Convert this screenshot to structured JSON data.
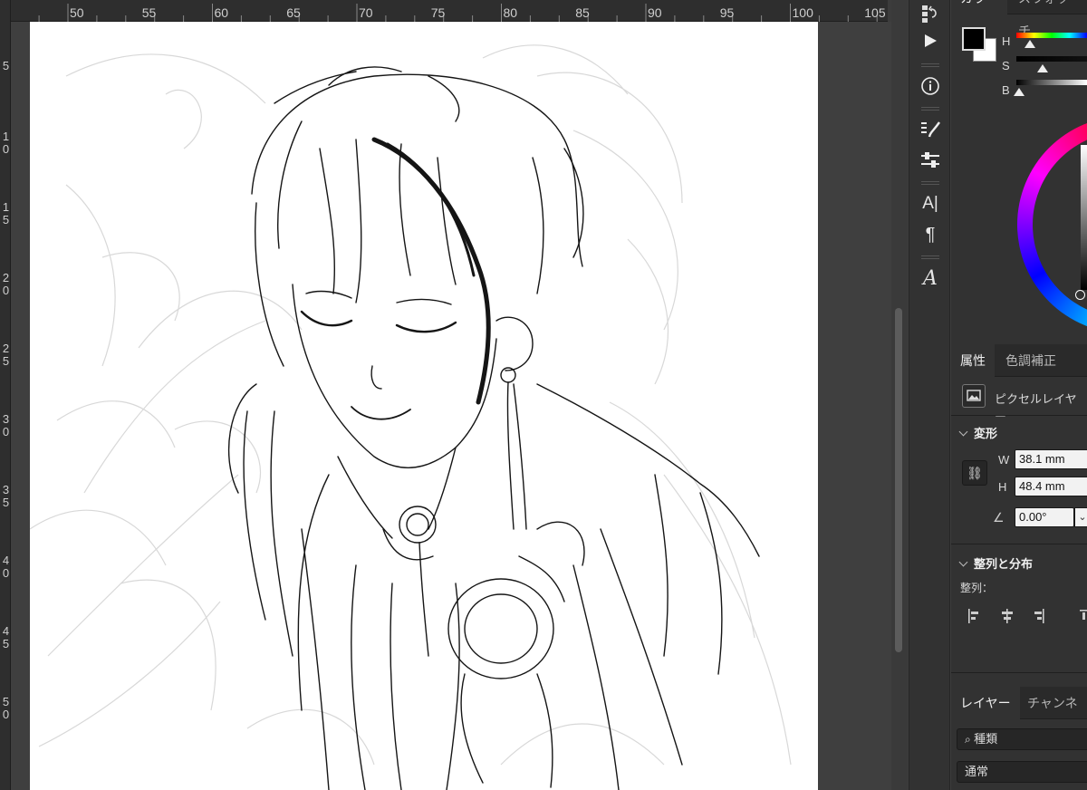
{
  "ruler": {
    "top_labels": [
      "50",
      "55",
      "60",
      "65",
      "70",
      "75",
      "80",
      "85",
      "90",
      "95",
      "100",
      "105"
    ],
    "left_labels": [
      "5",
      "10",
      "15",
      "20",
      "25",
      "30",
      "35",
      "40",
      "45",
      "50"
    ]
  },
  "toolstrip": {
    "icons": [
      "history-icon",
      "play-icon",
      "info-icon",
      "brush-settings-icon",
      "adjustments-icon",
      "character-icon",
      "paragraph-icon",
      "glyphs-icon"
    ]
  },
  "color_panel": {
    "tabs": [
      "カラー",
      "スウォッチ"
    ],
    "h_label": "H",
    "s_label": "S",
    "b_label": "B",
    "h_level": 0.19,
    "s_level": 0.37,
    "b_level": 0.04,
    "foreground": "#000000",
    "background": "#ffffff"
  },
  "properties": {
    "tabs": [
      "属性",
      "色調補正"
    ],
    "layer_type": "ピクセルレイヤー",
    "transform_title": "変形",
    "w_label": "W",
    "w_value": "38.1 mm",
    "h_label": "H",
    "h_value": "48.4 mm",
    "angle_value": "0.00°",
    "align_title": "整列と分布",
    "align_label": "整列："
  },
  "layers_panel": {
    "tabs": [
      "レイヤー",
      "チャンネル"
    ],
    "filter_label": "種類",
    "blend_mode": "通常"
  },
  "colors": {
    "ui_dark": "#323232",
    "canvas": "#ffffff",
    "ink": "#111111"
  }
}
